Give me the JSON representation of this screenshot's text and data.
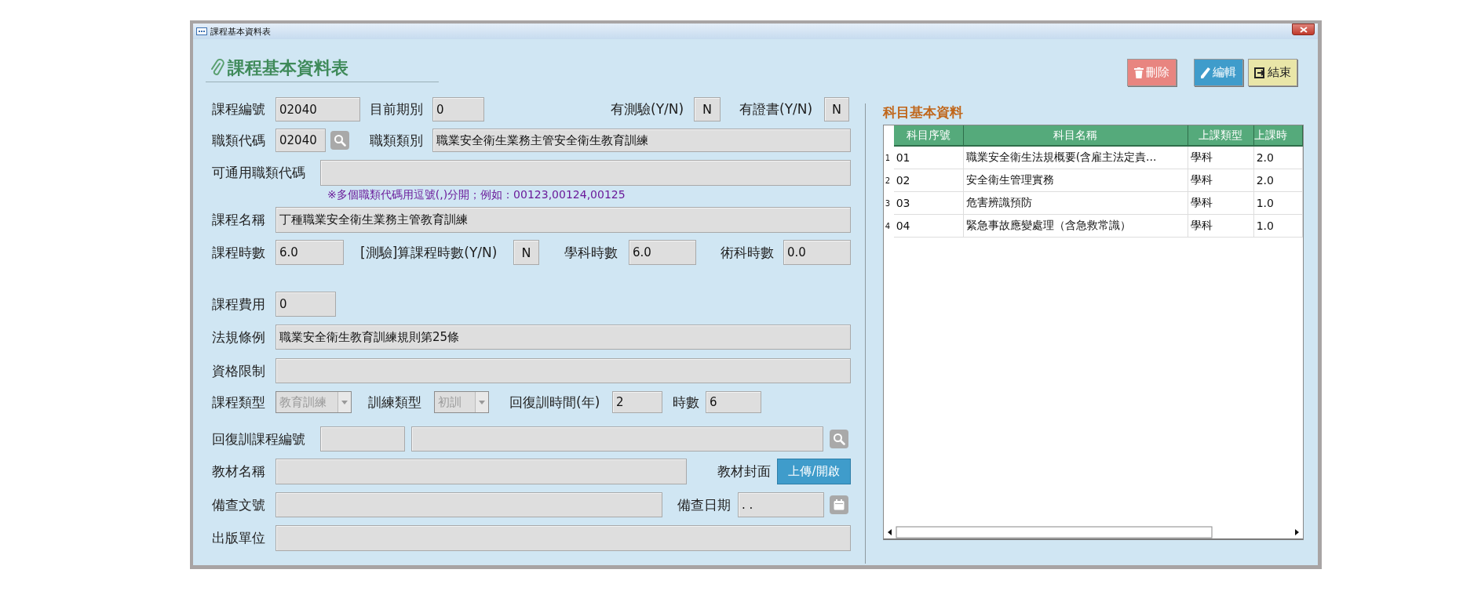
{
  "window": {
    "title": "課程基本資料表"
  },
  "header": {
    "title": "課程基本資料表"
  },
  "toolbar": {
    "buttons": [
      {
        "kind": "delete",
        "label": "刪除"
      },
      {
        "kind": "edit",
        "label": "編輯"
      },
      {
        "kind": "exit",
        "label": "結束"
      }
    ]
  },
  "form": {
    "rows": [
      {
        "items": [
          {
            "kind": "label",
            "text": "課程編號"
          },
          {
            "kind": "field",
            "value": "02040"
          },
          {
            "kind": "label",
            "text": "目前期別"
          },
          {
            "kind": "field",
            "value": "0"
          },
          {
            "kind": "label",
            "text": "有測驗(Y/N)"
          },
          {
            "kind": "yn",
            "value": "N"
          },
          {
            "kind": "label",
            "text": "有證書(Y/N)"
          },
          {
            "kind": "yn",
            "value": "N"
          }
        ]
      },
      {
        "items": [
          {
            "kind": "label",
            "text": "職類代碼"
          },
          {
            "kind": "field",
            "value": "02040"
          },
          {
            "kind": "search"
          },
          {
            "kind": "label",
            "text": "職類類別"
          },
          {
            "kind": "field",
            "value": "職業安全衛生業務主管安全衛生教育訓練"
          }
        ]
      },
      {
        "items": [
          {
            "kind": "label",
            "text": "可通用職類代碼"
          },
          {
            "kind": "field"
          }
        ]
      },
      {
        "items": [
          {
            "kind": "hint",
            "text": "※多個職類代碼用逗號(,)分開；例如：00123,00124,00125"
          }
        ]
      },
      {
        "items": [
          {
            "kind": "label",
            "text": "課程名稱"
          },
          {
            "kind": "field",
            "value": "丁種職業安全衛生業務主管教育訓練"
          }
        ]
      },
      {
        "items": [
          {
            "kind": "label",
            "text": "課程時數"
          },
          {
            "kind": "field",
            "value": "6.0"
          },
          {
            "kind": "label",
            "text": "[測驗]算課程時數(Y/N)"
          },
          {
            "kind": "yn",
            "value": "N"
          },
          {
            "kind": "label",
            "text": "學科時數"
          },
          {
            "kind": "field",
            "value": "6.0"
          },
          {
            "kind": "label",
            "text": "術科時數"
          },
          {
            "kind": "field",
            "value": "0.0"
          }
        ]
      },
      {
        "items": [
          {
            "kind": "label",
            "text": "課程費用"
          },
          {
            "kind": "field",
            "value": "0"
          }
        ]
      },
      {
        "items": [
          {
            "kind": "label",
            "text": "法規條例"
          },
          {
            "kind": "field",
            "value": "職業安全衛生教育訓練規則第25條"
          }
        ]
      },
      {
        "items": [
          {
            "kind": "label",
            "text": "資格限制"
          },
          {
            "kind": "field"
          }
        ]
      },
      {
        "items": [
          {
            "kind": "label",
            "text": "課程類型"
          },
          {
            "kind": "select",
            "value": "教育訓練",
            "disabled": true
          },
          {
            "kind": "label",
            "text": "訓練類型"
          },
          {
            "kind": "select",
            "value": "初訓",
            "disabled": true
          },
          {
            "kind": "label",
            "text": "回復訓時間(年)"
          },
          {
            "kind": "field",
            "value": "2"
          },
          {
            "kind": "label",
            "text": "時數"
          },
          {
            "kind": "field",
            "value": "6"
          }
        ]
      },
      {
        "items": [
          {
            "kind": "label",
            "text": "回復訓課程編號"
          },
          {
            "kind": "field"
          },
          {
            "kind": "field"
          },
          {
            "kind": "search"
          }
        ]
      },
      {
        "items": [
          {
            "kind": "label",
            "text": "教材名稱"
          },
          {
            "kind": "field"
          },
          {
            "kind": "label",
            "text": "教材封面"
          },
          {
            "kind": "button",
            "label": "上傳/開啟"
          }
        ]
      },
      {
        "items": [
          {
            "kind": "label",
            "text": "備查文號"
          },
          {
            "kind": "field"
          },
          {
            "kind": "label",
            "text": "備查日期"
          },
          {
            "kind": "field",
            "value": ". ."
          },
          {
            "kind": "calendar"
          }
        ]
      },
      {
        "items": [
          {
            "kind": "label",
            "text": "出版單位"
          },
          {
            "kind": "field"
          }
        ]
      }
    ]
  },
  "subjects": {
    "title": "科目基本資料",
    "columns": [
      "科目序號",
      "科目名稱",
      "上課類型",
      "上課時"
    ],
    "rows": [
      {
        "number": "1",
        "cells": [
          "01",
          "職業安全衛生法規概要(含雇主法定責...",
          "學科",
          "2.0"
        ]
      },
      {
        "number": "2",
        "cells": [
          "02",
          "安全衛生管理實務",
          "學科",
          "2.0"
        ]
      },
      {
        "number": "3",
        "cells": [
          "03",
          "危害辨識預防",
          "學科",
          "1.0"
        ]
      },
      {
        "number": "4",
        "cells": [
          "04",
          "緊急事故應變處理（含急救常識）",
          "學科",
          "1.0"
        ]
      }
    ]
  }
}
